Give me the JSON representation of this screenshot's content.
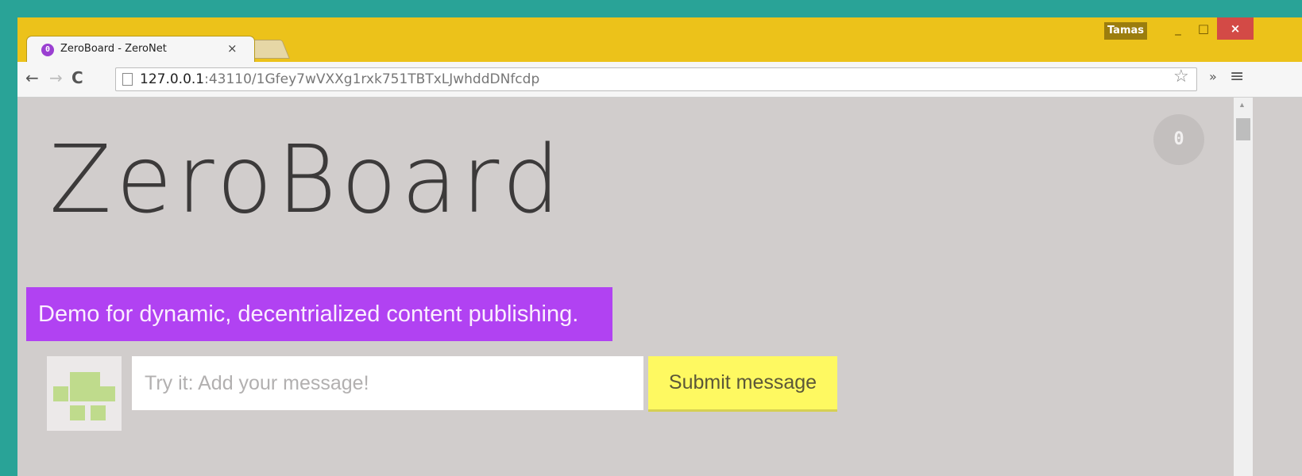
{
  "browser": {
    "tab": {
      "title": "ZeroBoard - ZeroNet",
      "favicon_text": "0",
      "close_symbol": "×"
    },
    "profile_name": "Tamas",
    "window_controls": {
      "minimize": "_",
      "maximize": "□",
      "close": "×"
    },
    "nav": {
      "back": "←",
      "forward": "→",
      "reload": "C"
    },
    "address": {
      "host": "127.0.0.1",
      "rest": ":43110/1Gfey7wVXXg1rxk751TBTxLJwhddDNfcdp"
    },
    "toolbar_icons": {
      "star": "☆",
      "extensions": "»",
      "menu": "≡"
    }
  },
  "page": {
    "counter": "0",
    "logo": "ZeroBoard",
    "tagline": "Demo for dynamic, decentrialized content publishing.",
    "composer": {
      "placeholder": "Try it: Add your message!",
      "value": "",
      "submit_label": "Submit message"
    }
  },
  "colors": {
    "desktop": "#29a397",
    "titlebar": "#ecc21a",
    "page_bg": "#d1cdcc",
    "tagline_bg": "#b142f2",
    "submit_bg": "#fef961",
    "avatar_pixels": "#bfdb8c",
    "close_button": "#d34a46"
  }
}
